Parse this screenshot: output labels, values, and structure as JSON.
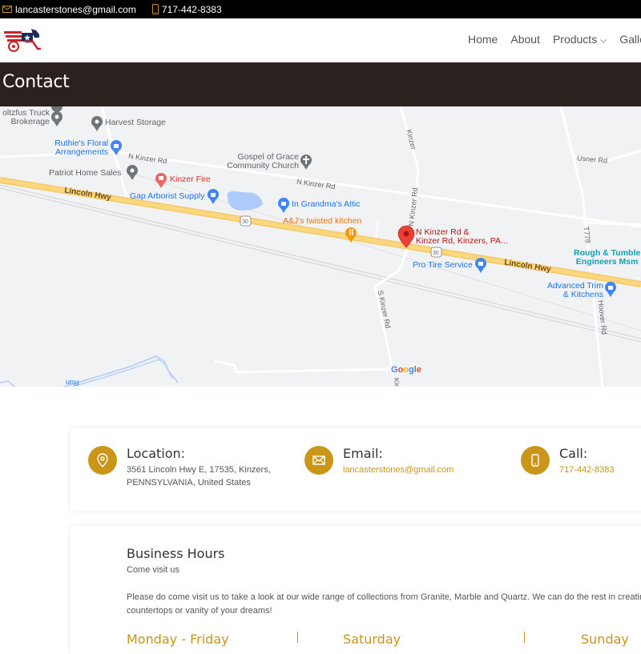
{
  "topbar": {
    "email": "lancasterstones@gmail.com",
    "phone": "717-442-8383"
  },
  "nav": {
    "items": [
      {
        "label": "Home"
      },
      {
        "label": "About"
      },
      {
        "label": "Products",
        "has_dropdown": true
      },
      {
        "label": "Gallery"
      }
    ]
  },
  "page_title": "Contact",
  "map": {
    "pin_label_line1": "N Kinzer Rd &",
    "pin_label_line2": "Kinzer Rd, Kinzers, PA...",
    "places": {
      "stoltzfus_1": "oltzfus Truck",
      "stoltzfus_2": "Brokerage",
      "harvest": "Harvest Storage",
      "ruthies_1": "Ruthie's Floral",
      "ruthies_2": "Arrangements",
      "patriot": "Patriot Home Sales",
      "kinzer_fire": "Kinzer Fire",
      "gospel_1": "Gospel of Grace",
      "gospel_2": "Community Church",
      "gap": "Gap Arborist Supply",
      "grandma": "In Grandma's Attic",
      "aj": "A&J's twisted kitchen",
      "pro_tire": "Pro Tire Service",
      "rough_1": "Rough & Tumble",
      "rough_2": "Engineers Msm",
      "advanced_1": "Advanced Trim",
      "advanced_2": "& Kitchens"
    },
    "roads": {
      "lincoln_1": "Lincoln Hwy",
      "lincoln_2": "Lincoln Hwy",
      "nkinzer_1": "N Kinzer Rd",
      "nkinzer_2": "N Kinzer Rd",
      "nkinzer_v": "N Kinzer Rd",
      "kinzer_v": "Kinzer",
      "skinzer": "S Kinzer Rd",
      "usner": "Usner Rd",
      "t778": "T778",
      "hoover": "Hoover Rd",
      "route": "30",
      "run": "Run",
      "kin": "Kin"
    },
    "attribution": "Google"
  },
  "contact": {
    "location": {
      "title": "Location:",
      "line1": "3561 Lincoln Hwy E, 17535, Kinzers,",
      "line2": "PENNSYLVANIA, United States"
    },
    "email": {
      "title": "Email:",
      "value": "lancasterstones@gmail.com"
    },
    "call": {
      "title": "Call:",
      "value": "717-442-8383"
    }
  },
  "hours": {
    "title": "Business Hours",
    "subtitle": "Come visit us",
    "paragraph_line1": "Please do come visit us to take a look at our wide range of collections from Granite, Marble and Quartz. We can do the rest in creating the",
    "paragraph_line2": "countertops or vanity of your dreams!",
    "days": [
      "Monday - Friday",
      "Saturday",
      "Sunday"
    ]
  },
  "colors": {
    "accent": "#c9961a",
    "title_band": "#2b2220",
    "topbar": "#000000"
  }
}
